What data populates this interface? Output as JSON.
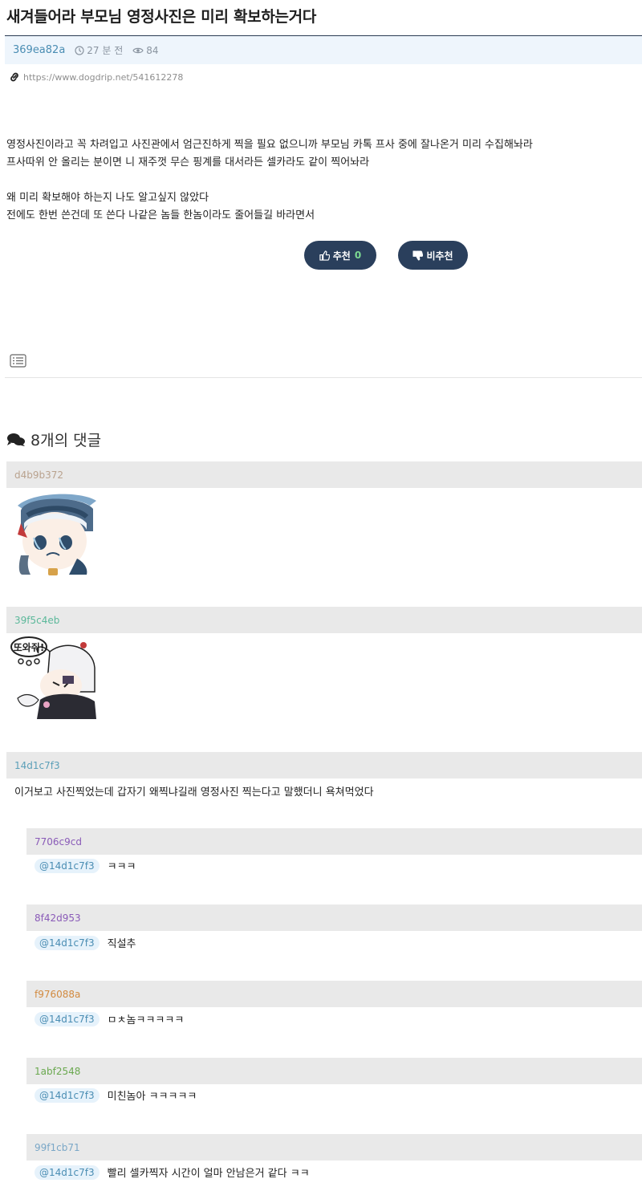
{
  "post": {
    "title": "새겨들어라 부모님 영정사진은 미리 확보하는거다",
    "author": "369ea82a",
    "time": "27 분 전",
    "views": "84",
    "url": "https://www.dogdrip.net/541612278",
    "lines": [
      "영정사진이라고 꼭 차려입고 사진관에서 엄근진하게 찍을 필요 없으니까 부모님 카톡 프사 중에 잘나온거 미리 수집해놔라",
      "프사따위 안 올리는 분이면 니 재주껏 무슨 핑계를 대서라든 셀카라도 같이 찍어놔라",
      "왜 미리 확보해야 하는지 나도 알고싶지 않았다",
      "전에도 한번 쓴건데 또 쓴다 나같은 놈들 한놈이라도 줄어들길 바라면서"
    ]
  },
  "votes": {
    "up_label": "추천",
    "up_count": "0",
    "down_label": "비추천"
  },
  "comments_heading": "8개의 댓글",
  "comments": [
    {
      "author": "d4b9b372",
      "color": "#b9a28e"
    },
    {
      "author": "39f5c4eb",
      "color": "#5bb89a"
    },
    {
      "author": "14d1c7f3",
      "color": "#5b9fb8",
      "text": "이거보고 사진찍었는데 갑자기 왜찍냐길래 영정사진 찍는다고 말했더니 욕쳐먹었다"
    }
  ],
  "replies": [
    {
      "author": "7706c9cd",
      "color": "#8a5bb8",
      "mention": "@14d1c7f3",
      "text": "ㅋㅋㅋ"
    },
    {
      "author": "8f42d953",
      "color": "#8a5bb8",
      "mention": "@14d1c7f3",
      "text": "직설추"
    },
    {
      "author": "f976088a",
      "color": "#d28a3f",
      "mention": "@14d1c7f3",
      "text": "ㅁㅊ놈ㅋㅋㅋㅋㅋ"
    },
    {
      "author": "1abf2548",
      "color": "#6aa84f",
      "mention": "@14d1c7f3",
      "text": "미친놈아 ㅋㅋㅋㅋㅋ"
    },
    {
      "author": "99f1cb71",
      "color": "#7aa7c7",
      "mention": "@14d1c7f3",
      "text": "빨리 셀카찍자 시간이 얼마 안남은거 같다 ㅋㅋ"
    }
  ],
  "sticker_text": "또와줘!"
}
